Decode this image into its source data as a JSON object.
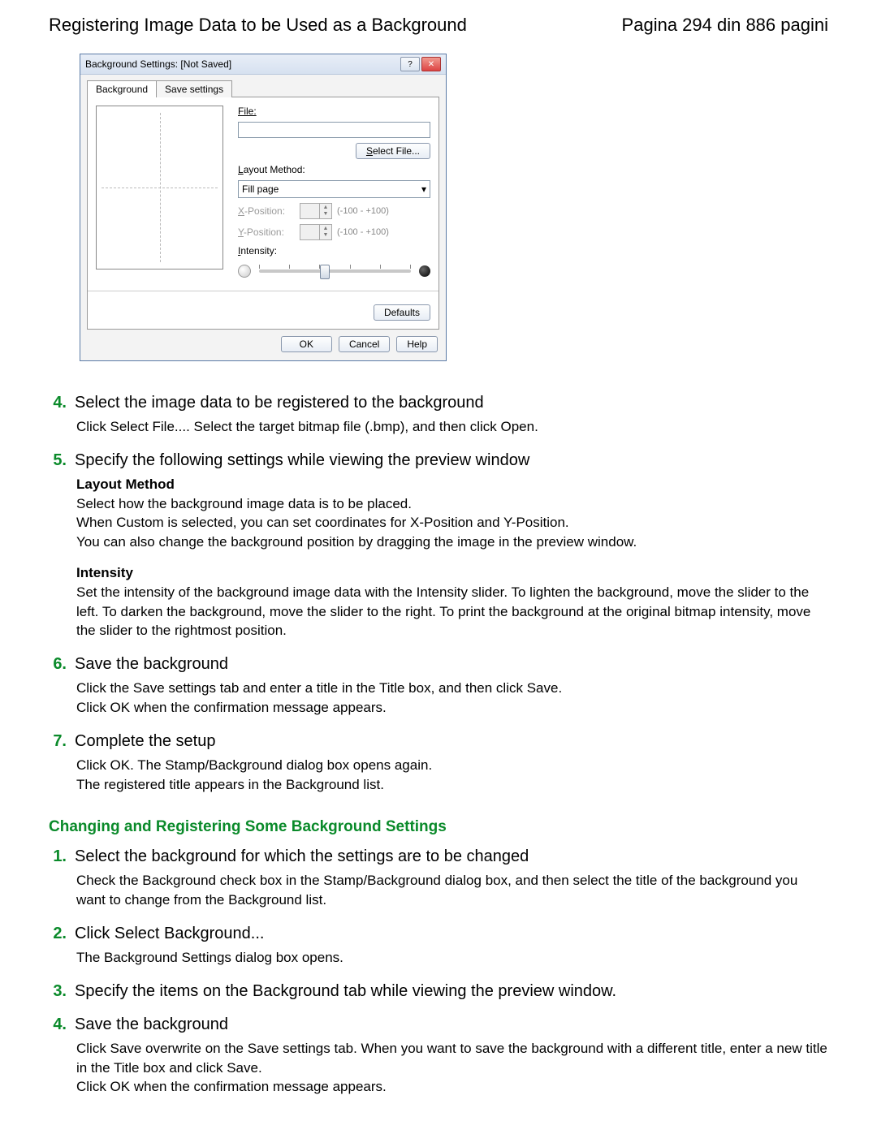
{
  "header": {
    "title": "Registering Image Data to be Used as a Background",
    "page_info": "Pagina 294 din 886 pagini"
  },
  "dialog": {
    "title": "Background Settings: [Not Saved]",
    "win_help": "?",
    "win_close": "✕",
    "tabs": {
      "background": "Background",
      "save": "Save settings"
    },
    "file_label": "File:",
    "select_file_u": "S",
    "select_file_rest": "elect File...",
    "layout_label_u": "L",
    "layout_label_rest": "ayout Method:",
    "layout_value": "Fill page",
    "xpos_u": "X",
    "xpos_rest": "-Position:",
    "ypos_u": "Y",
    "ypos_rest": "-Position:",
    "range_hint": "(-100 - +100)",
    "intensity_label_u": "I",
    "intensity_label_rest": "ntensity:",
    "defaults": "Defaults",
    "ok": "OK",
    "cancel": "Cancel",
    "help": "Help",
    "dropdown_caret": "▾"
  },
  "steps_a": [
    {
      "num": "4.",
      "title": "Select the image data to be registered to the background",
      "body": "Click Select File.... Select the target bitmap file (.bmp), and then click Open."
    },
    {
      "num": "5.",
      "title": "Specify the following settings while viewing the preview window"
    }
  ],
  "section5": {
    "layout_h": "Layout Method",
    "layout_p1": "Select how the background image data is to be placed.",
    "layout_p2": "When Custom is selected, you can set coordinates for X-Position and Y-Position.",
    "layout_p3": "You can also change the background position by dragging the image in the preview window.",
    "intensity_h": "Intensity",
    "intensity_p": "Set the intensity of the background image data with the Intensity slider. To lighten the background, move the slider to the left. To darken the background, move the slider to the right. To print the background at the original bitmap intensity, move the slider to the rightmost position."
  },
  "steps_b": [
    {
      "num": "6.",
      "title": "Save the background",
      "body1": "Click the Save settings tab and enter a title in the Title box, and then click Save.",
      "body2": "Click OK when the confirmation message appears."
    },
    {
      "num": "7.",
      "title": "Complete the setup",
      "body1": "Click OK. The Stamp/Background dialog box opens again.",
      "body2": "The registered title appears in the Background list."
    }
  ],
  "section_change": {
    "heading": "Changing and Registering Some Background Settings",
    "steps": [
      {
        "num": "1.",
        "title": "Select the background for which the settings are to be changed",
        "body": "Check the Background check box in the Stamp/Background dialog box, and then select the title of the background you want to change from the Background list."
      },
      {
        "num": "2.",
        "title": "Click Select Background...",
        "body": "The Background Settings dialog box opens."
      },
      {
        "num": "3.",
        "title": "Specify the items on the Background tab while viewing the preview window."
      },
      {
        "num": "4.",
        "title": "Save the background",
        "body1": "Click Save overwrite on the Save settings tab. When you want to save the background with a different title, enter a new title in the Title box and click Save.",
        "body2": "Click OK when the confirmation message appears."
      }
    ]
  }
}
